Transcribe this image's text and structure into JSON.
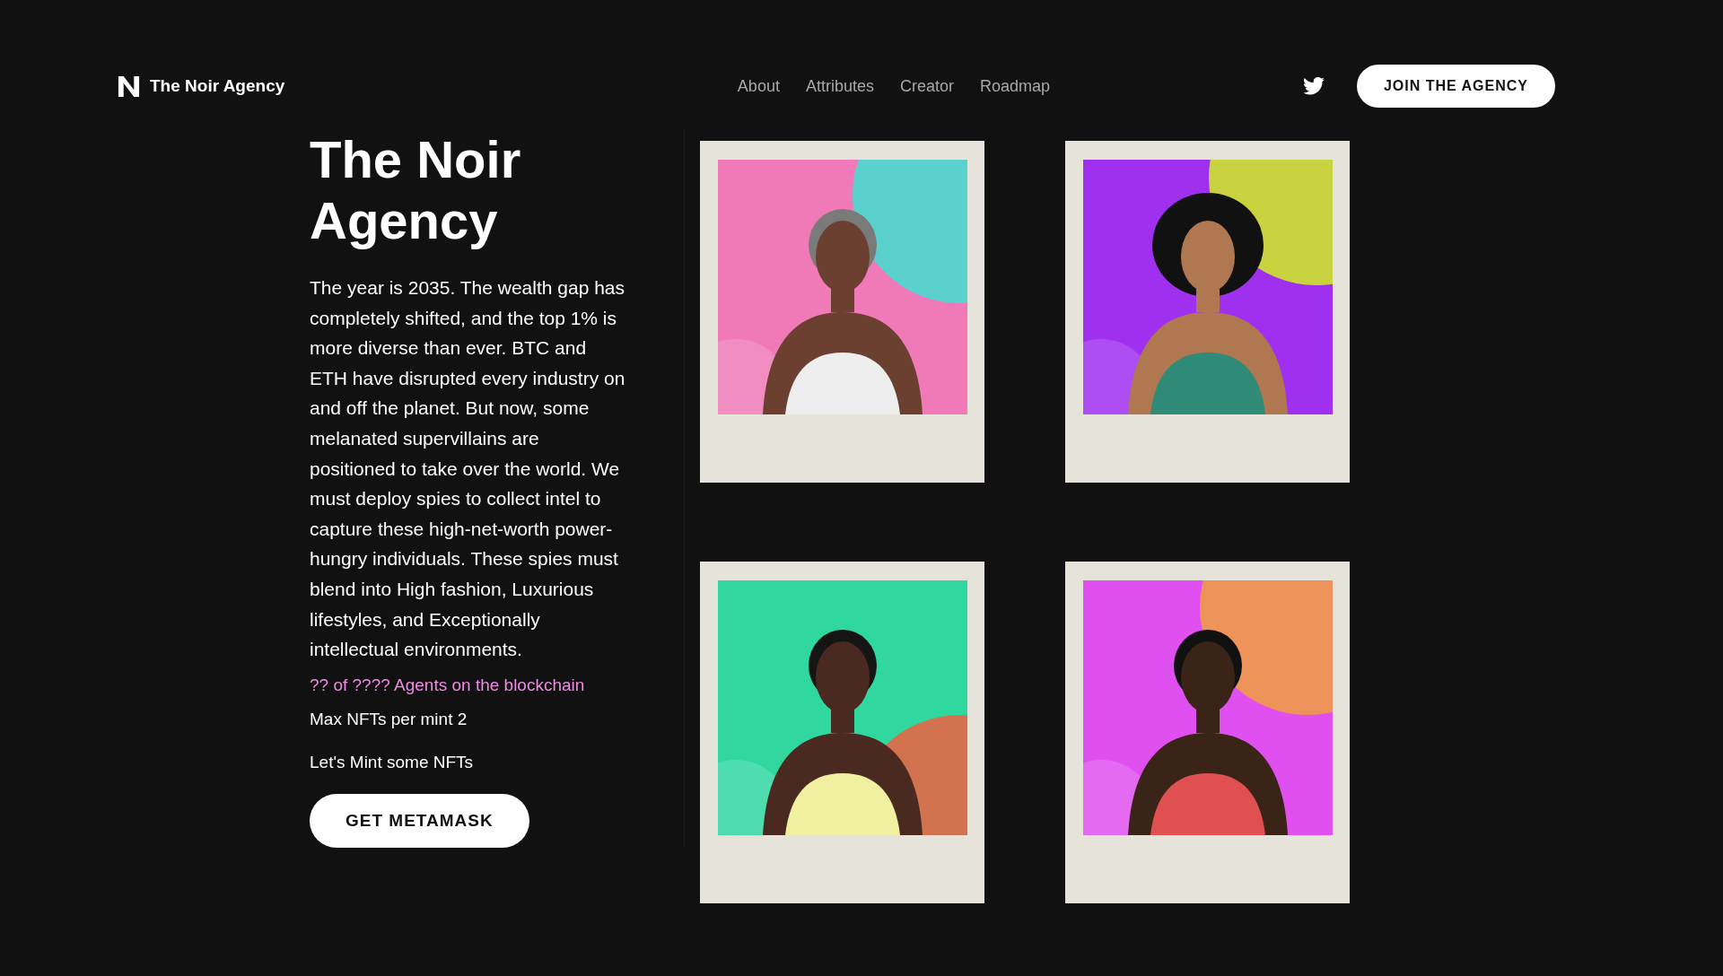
{
  "header": {
    "logo": "The Noir Agency",
    "nav": [
      {
        "label": "About"
      },
      {
        "label": "Attributes"
      },
      {
        "label": "Creator"
      },
      {
        "label": "Roadmap"
      }
    ],
    "cta": "JOIN THE AGENCY"
  },
  "hero": {
    "title": "The Noir Agency",
    "description": "The year is 2035. The wealth gap has completely shifted, and the top 1% is more diverse than ever. BTC and ETH have disrupted every industry on and off the planet. But now, some melanated supervillains are positioned to take over the world. We must deploy spies to collect intel to capture these high-net-worth power-hungry individuals. These spies must blend into High fashion, Luxurious lifestyles, and Exceptionally intellectual environments.",
    "supply": "?? of ???? Agents on the blockchain",
    "max_per_mint": "Max NFTs per mint 2",
    "mint_prompt": "Let's Mint some NFTs",
    "button": "GET METAMASK"
  }
}
